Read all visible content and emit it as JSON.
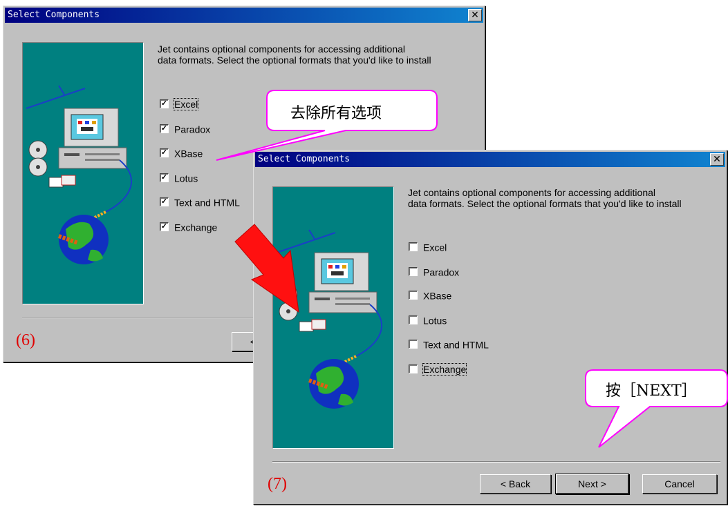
{
  "dialog6": {
    "title": "Select Components",
    "close_glyph": "✕",
    "intro": "Jet contains optional components for accessing additional\ndata formats. Select the optional formats that you'd like to install",
    "options": [
      {
        "label": "Excel",
        "checked": true
      },
      {
        "label": "Paradox",
        "checked": true
      },
      {
        "label": "XBase",
        "checked": true
      },
      {
        "label": "Lotus",
        "checked": true
      },
      {
        "label": "Text and HTML",
        "checked": true
      },
      {
        "label": "Exchange",
        "checked": true
      }
    ],
    "back_label_partial": "<",
    "step_label": "(6)"
  },
  "dialog7": {
    "title": "Select Components",
    "close_glyph": "✕",
    "intro": "Jet contains optional components for accessing additional\ndata formats. Select the optional formats that you'd like to install",
    "options": [
      {
        "label": "Excel",
        "checked": false
      },
      {
        "label": "Paradox",
        "checked": false
      },
      {
        "label": "XBase",
        "checked": false
      },
      {
        "label": "Lotus",
        "checked": false
      },
      {
        "label": "Text and HTML",
        "checked": false
      },
      {
        "label": "Exchange",
        "checked": false
      }
    ],
    "buttons": {
      "back": "< Back",
      "next": "Next >",
      "cancel": "Cancel"
    },
    "step_label": "(7)"
  },
  "annotations": {
    "callout1": "去除所有选项",
    "callout2": "按［NEXT］"
  },
  "colors": {
    "titlebar": "#000080",
    "dialog_bg": "#c0c0c0",
    "art_bg": "#008080",
    "step_label": "#e00000",
    "callout_border": "#ff00ff",
    "arrow": "#ff0000"
  },
  "icons": {
    "close": "close-icon",
    "arrow": "red-arrow-icon",
    "computer": "computer-illustration",
    "globe": "globe-illustration"
  }
}
